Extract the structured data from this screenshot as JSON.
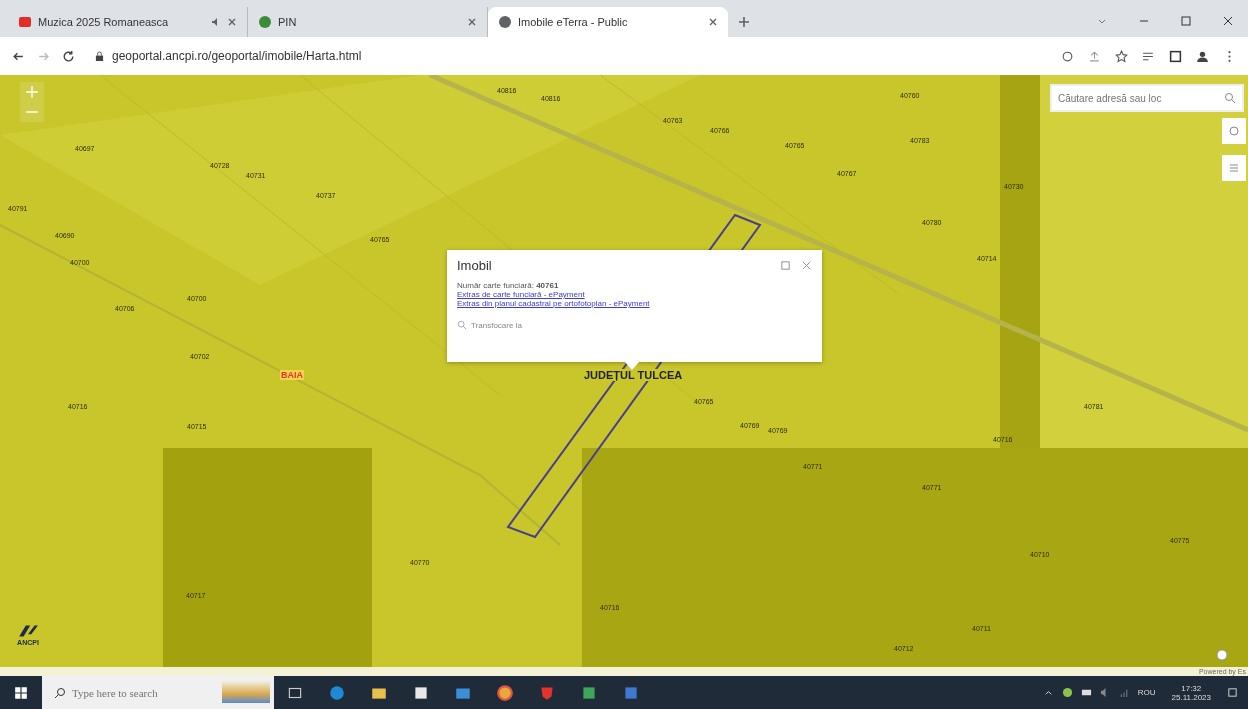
{
  "browser": {
    "tabs": [
      {
        "title": "Muzica 2025 Romaneasca",
        "selected": false,
        "audio": true
      },
      {
        "title": "PIN",
        "selected": false,
        "audio": false
      },
      {
        "title": "Imobile eTerra - Public",
        "selected": true,
        "audio": false
      }
    ],
    "url": "geoportal.ancpi.ro/geoportal/imobile/Harta.html"
  },
  "map": {
    "search": {
      "placeholder": "Căutare adresă sau loc"
    },
    "parcel_labels": [
      "40816",
      "40816",
      "40760",
      "40763",
      "40766",
      "40765",
      "40767",
      "40783",
      "40697",
      "40728",
      "40731",
      "40737",
      "40791",
      "40730",
      "40780",
      "40690",
      "40765",
      "40700",
      "40714",
      "40700",
      "40706",
      "40702",
      "40716",
      "40715",
      "40765",
      "40781",
      "40769",
      "40769",
      "40716",
      "40771",
      "40771",
      "40775",
      "40770",
      "40710",
      "40717",
      "40716",
      "40711",
      "40712"
    ],
    "place_label": "BAIA",
    "region_label": "JUDEȚUL TULCEA",
    "logo_text": "ANCPI",
    "attribution": "Powered by Es",
    "popup": {
      "title": "Imobil",
      "info": "Număr carte funciară: **40761**",
      "links": [
        "Extras de carte funciară - ePayment",
        "Extras din planul cadastral pe ortofotoplan - ePayment"
      ],
      "action": "Transfocare la"
    }
  },
  "taskbar": {
    "search_placeholder": "Type here to search",
    "language": "ROU",
    "time": "17:32",
    "date": "25.11.2023"
  }
}
